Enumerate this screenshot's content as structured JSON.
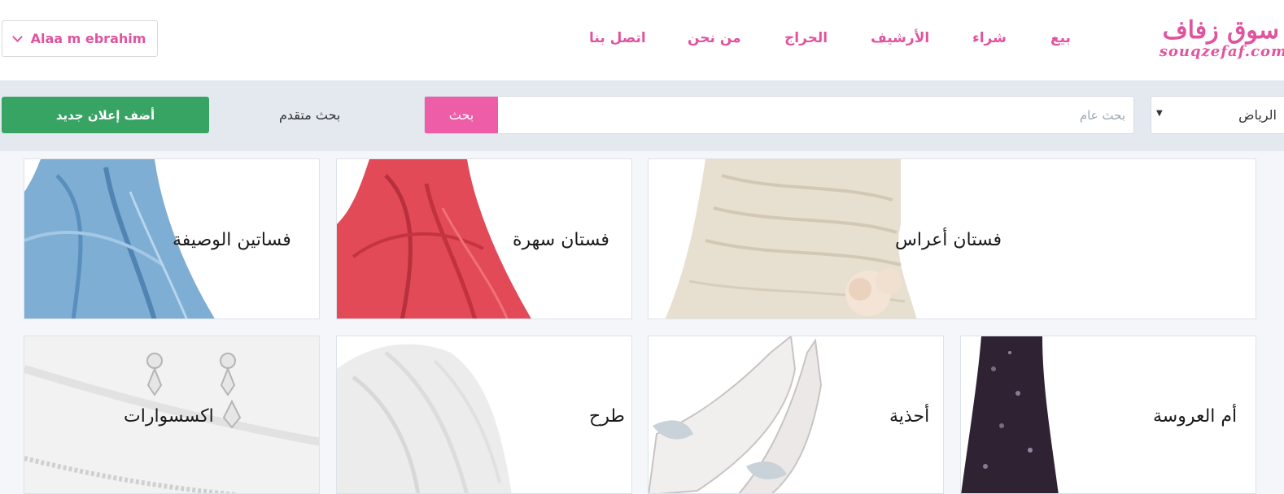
{
  "header": {
    "user_name": "Alaa m ebrahim",
    "logo_ar": "سوق زفاف",
    "logo_en": "souqzefaf.com",
    "nav": [
      {
        "label": "بيع"
      },
      {
        "label": "شراء"
      },
      {
        "label": "الأرشيف"
      },
      {
        "label": "الحراج"
      },
      {
        "label": "من نحن"
      },
      {
        "label": "اتصل بنا"
      }
    ]
  },
  "search": {
    "add_label": "أضف إعلان جديد",
    "advanced_label": "بحث متقدم",
    "button_label": "بحث",
    "placeholder": "بحث عام",
    "city": "الرياض"
  },
  "categories": [
    {
      "label": "فستان أعراس"
    },
    {
      "label": "فستان سهرة"
    },
    {
      "label": "فساتين الوصيفة"
    },
    {
      "label": "أم العروسة"
    },
    {
      "label": "أحذية"
    },
    {
      "label": "طرح"
    },
    {
      "label": "اكسسوارات"
    }
  ],
  "colors": {
    "brand_pink": "#e0549f",
    "search_pink": "#ee5da8",
    "add_green": "#37a463"
  }
}
